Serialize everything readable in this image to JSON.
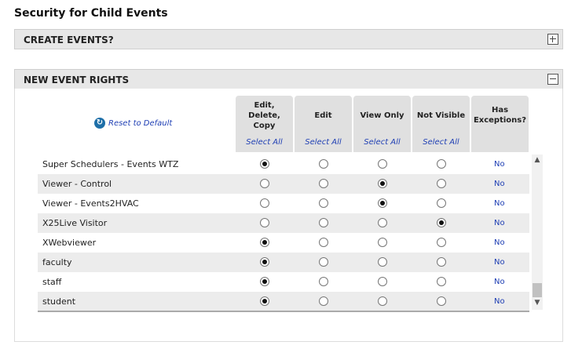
{
  "page_title": "Security for Child Events",
  "sections": {
    "create_events": "CREATE EVENTS?",
    "new_event_rights": "NEW EVENT RIGHTS"
  },
  "reset_link": "Reset to Default",
  "columns": [
    {
      "label_lines": [
        "Edit,",
        "Delete,",
        "Copy"
      ],
      "select": "Select All"
    },
    {
      "label_lines": [
        "Edit"
      ],
      "select": "Select All"
    },
    {
      "label_lines": [
        "View Only"
      ],
      "select": "Select All"
    },
    {
      "label_lines": [
        "Not Visible"
      ],
      "select": "Select All"
    },
    {
      "label_lines": [
        "Has",
        "Exceptions?"
      ],
      "select": ""
    }
  ],
  "rows": [
    {
      "name": "Super Schedulers - Events WTZ",
      "selected": 0,
      "exceptions": "No"
    },
    {
      "name": "Viewer - Control",
      "selected": 2,
      "exceptions": "No"
    },
    {
      "name": "Viewer - Events2HVAC",
      "selected": 2,
      "exceptions": "No"
    },
    {
      "name": "X25Live Visitor",
      "selected": 3,
      "exceptions": "No"
    },
    {
      "name": "XWebviewer",
      "selected": 0,
      "exceptions": "No"
    },
    {
      "name": "faculty",
      "selected": 0,
      "exceptions": "No"
    },
    {
      "name": "staff",
      "selected": 0,
      "exceptions": "No"
    },
    {
      "name": "student",
      "selected": 0,
      "exceptions": "No"
    }
  ]
}
